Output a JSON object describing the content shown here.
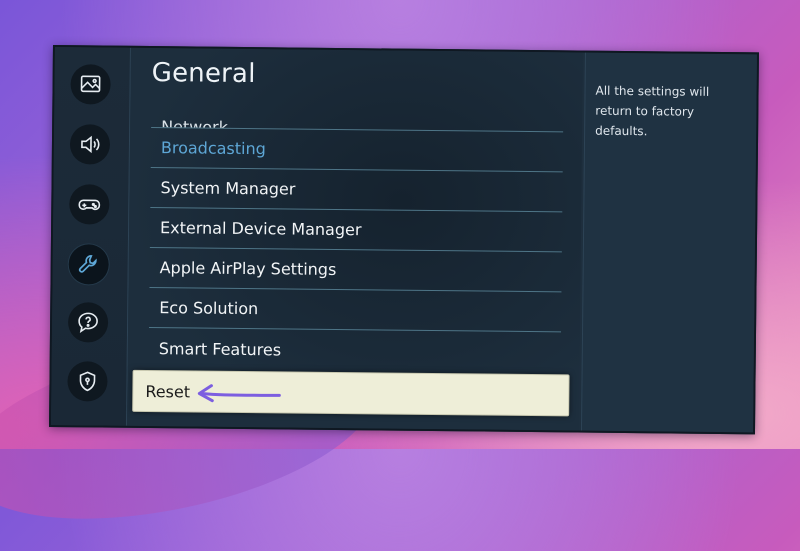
{
  "menu": {
    "title": "General",
    "items": [
      {
        "label": "Network",
        "state": "partial"
      },
      {
        "label": "Broadcasting",
        "state": "highlighted"
      },
      {
        "label": "System Manager",
        "state": "normal"
      },
      {
        "label": "External Device Manager",
        "state": "normal"
      },
      {
        "label": "Apple AirPlay Settings",
        "state": "normal"
      },
      {
        "label": "Eco Solution",
        "state": "normal"
      },
      {
        "label": "Smart Features",
        "state": "normal"
      },
      {
        "label": "Reset",
        "state": "selected"
      }
    ]
  },
  "description": "All the settings will return to factory defaults.",
  "sidebar": {
    "icons": [
      {
        "name": "picture-icon",
        "active": false
      },
      {
        "name": "sound-icon",
        "active": false
      },
      {
        "name": "game-controller-icon",
        "active": false
      },
      {
        "name": "wrench-icon",
        "active": true
      },
      {
        "name": "support-icon",
        "active": false
      },
      {
        "name": "privacy-shield-icon",
        "active": false
      }
    ]
  },
  "colors": {
    "panel": "#1e2f3e",
    "highlight_text": "#5ea7d6",
    "selected_bg": "#eeeed8",
    "arrow": "#7c5ee0"
  }
}
